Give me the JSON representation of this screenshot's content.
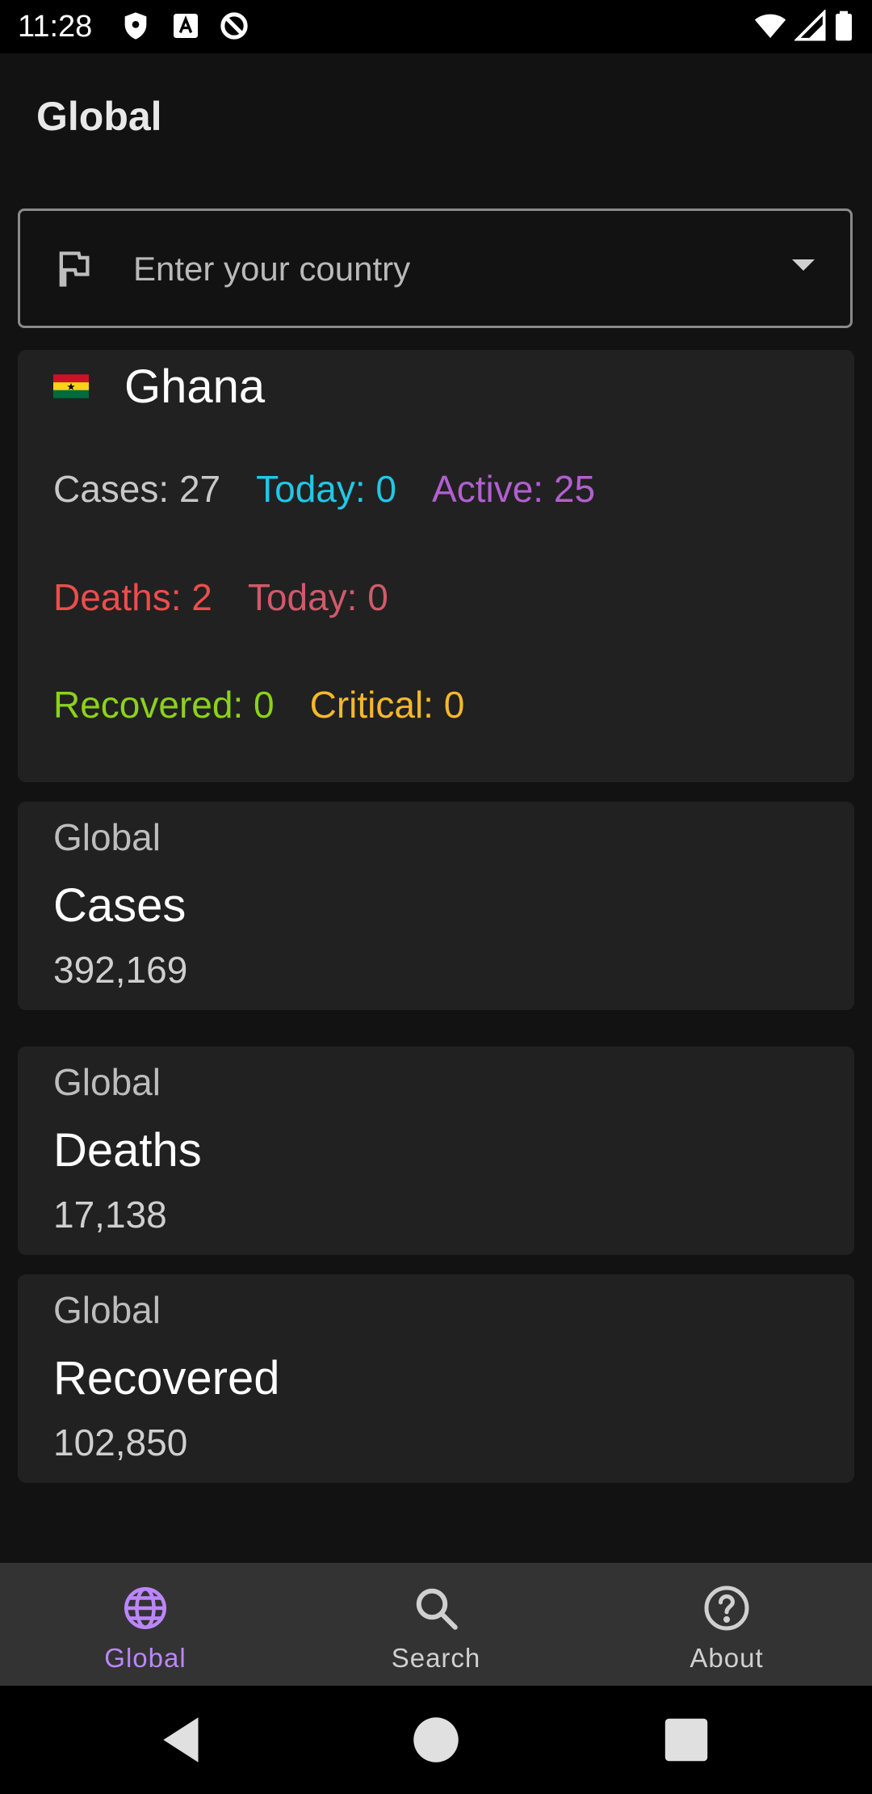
{
  "status_bar": {
    "time": "11:28"
  },
  "app_bar": {
    "title": "Global"
  },
  "country_input": {
    "placeholder": "Enter your country",
    "value": "",
    "leading_icon": "flag-outline-icon",
    "trailing_icon": "dropdown-arrow-icon"
  },
  "country_card": {
    "name": "Ghana",
    "flag_colors": [
      "#ce1126",
      "#fcd116",
      "#006b3f"
    ],
    "cases": "Cases: 27",
    "today": "Today: 0",
    "active": "Active: 25",
    "deaths": "Deaths: 2",
    "deaths_today": "Today: 0",
    "recovered": "Recovered: 0",
    "critical": "Critical: 0"
  },
  "global_cards": [
    {
      "label": "Global",
      "title": "Cases",
      "value": "392,169"
    },
    {
      "label": "Global",
      "title": "Deaths",
      "value": "17,138"
    },
    {
      "label": "Global",
      "title": "Recovered",
      "value": "102,850"
    }
  ],
  "bottom_nav": {
    "items": [
      {
        "label": "Global",
        "icon": "globe-icon",
        "active": true
      },
      {
        "label": "Search",
        "icon": "search-icon",
        "active": false
      },
      {
        "label": "About",
        "icon": "help-circle-icon",
        "active": false
      }
    ],
    "active_color": "#bb86fc",
    "inactive_color": "#d0d0d0"
  },
  "colors": {
    "background": "#121212",
    "card": "#212121",
    "today": "#1fc8e8",
    "active": "#b25fd0",
    "deaths": "#ef4c4c",
    "deaths_today": "#d05a6a",
    "recovered": "#8cd21a",
    "critical": "#f5b829"
  }
}
